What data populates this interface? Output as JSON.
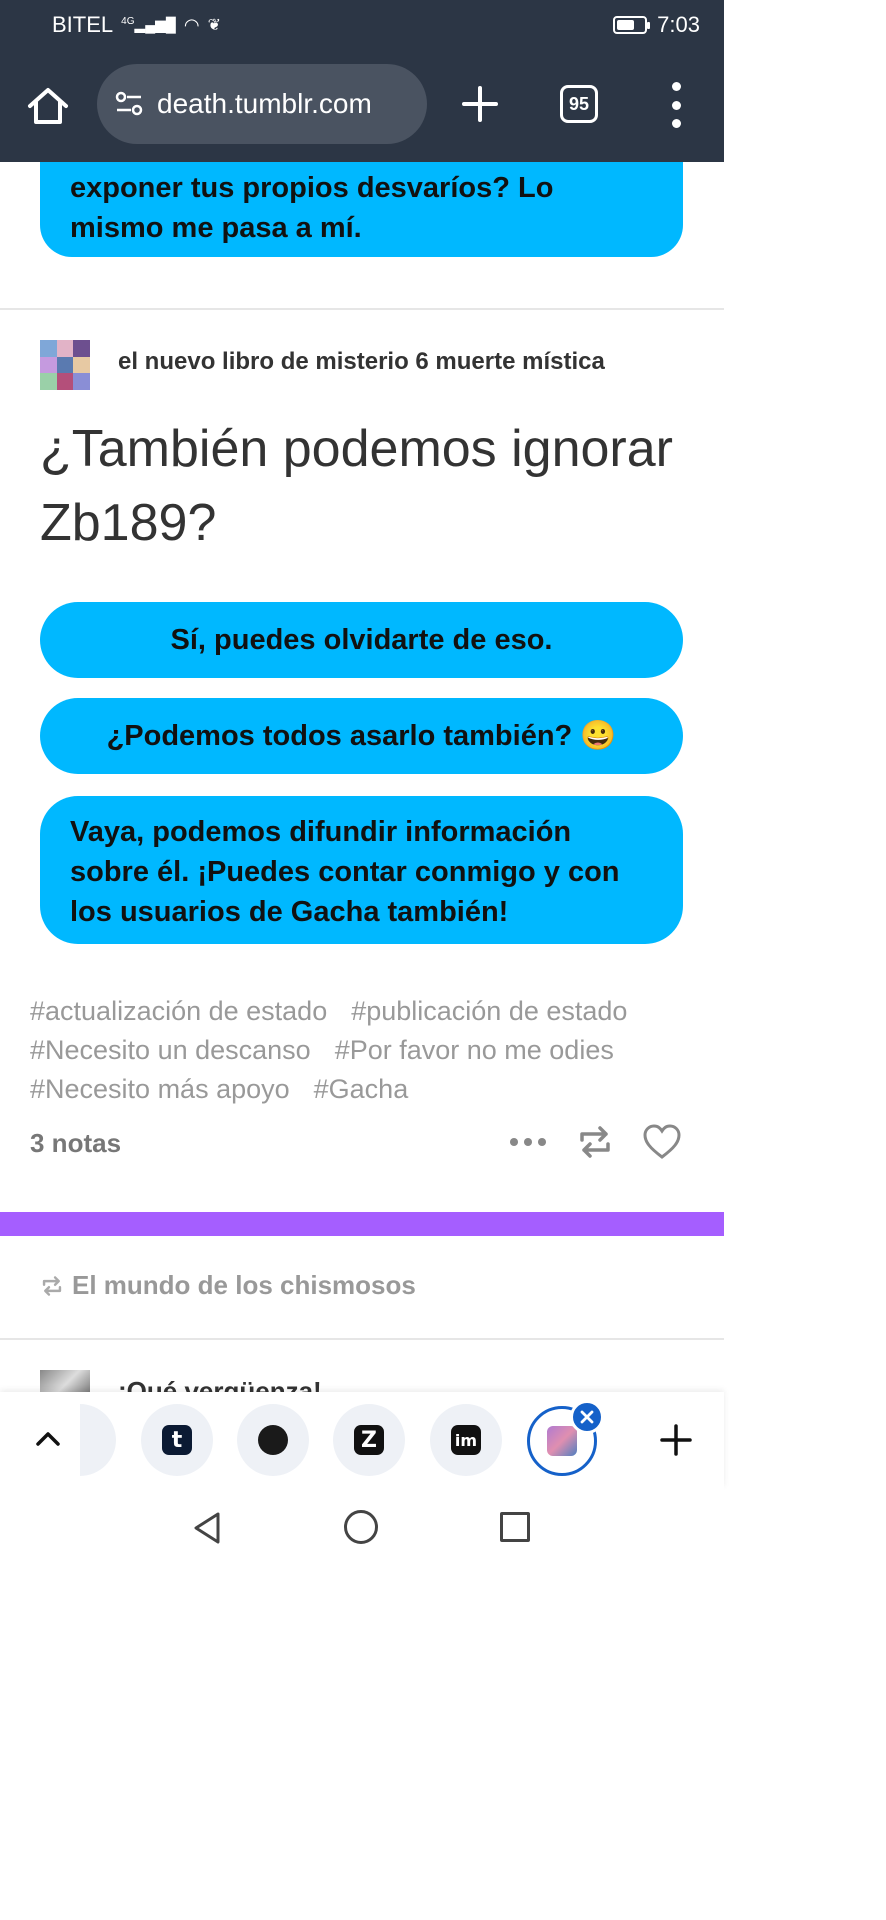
{
  "status_bar": {
    "carrier": "BITEL",
    "network": "4G",
    "time": "7:03",
    "battery_level": 0.55
  },
  "browser": {
    "url": "death.tumblr.com",
    "tab_count": "95"
  },
  "post_top": {
    "bubble_text": "exponer tus propios desvaríos? Lo mismo me pasa a mí."
  },
  "post": {
    "blog_name": "el nuevo libro de misterio 6 muerte mística",
    "title": "¿También podemos ignorar Zb189?",
    "choices": [
      "Sí, puedes olvidarte de eso.",
      "¿Podemos todos asarlo también? 😀",
      "Vaya, podemos difundir información sobre él. ¡Puedes contar conmigo y con los usuarios de Gacha también!"
    ],
    "tags": [
      "#actualización de estado",
      "#publicación de estado",
      "#Necesito un descanso",
      "#Por favor no me odies",
      "#Necesito más apoyo",
      "#Gacha"
    ],
    "notes": "3 notas"
  },
  "next_post": {
    "reblogged_from": "El mundo de los chismosos",
    "title": "¡Qué vergüenza!"
  },
  "tab_strip": {
    "items": [
      "t",
      "",
      "Z",
      "im"
    ]
  },
  "colors": {
    "chrome": "#2c3645",
    "bubble": "#00b8ff",
    "accent_purple": "#a55eff",
    "active_tab": "#1561c9"
  }
}
